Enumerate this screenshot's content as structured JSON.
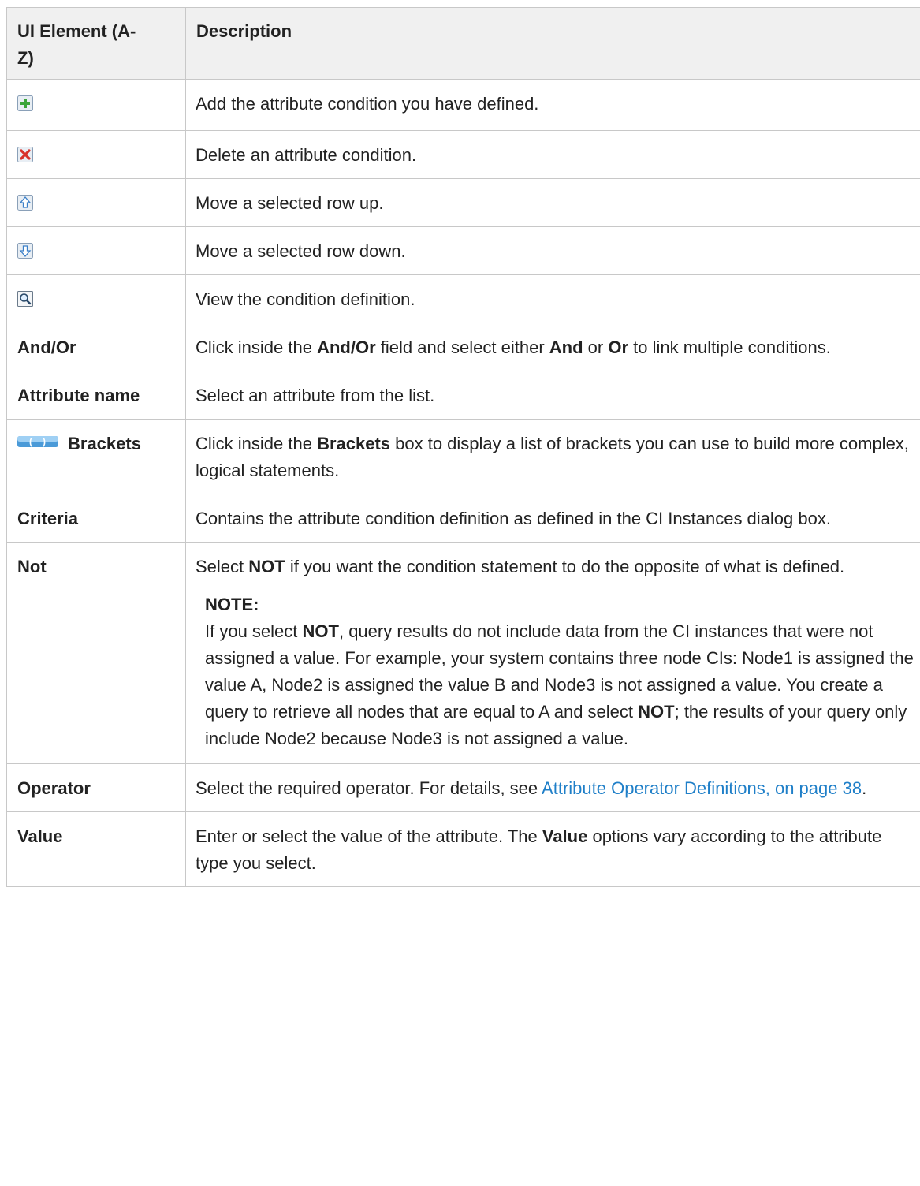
{
  "table": {
    "headers": [
      "UI Element (A-Z)",
      "Description"
    ],
    "header_element_line1": "UI Element (A-",
    "header_element_line2": "Z)"
  },
  "rows": {
    "add": {
      "icon": "add-icon",
      "desc": "Add the attribute condition you have defined."
    },
    "delete": {
      "icon": "delete-icon",
      "desc": "Delete an attribute condition."
    },
    "up": {
      "icon": "move-up-icon",
      "desc": "Move a selected row up."
    },
    "down": {
      "icon": "move-down-icon",
      "desc": "Move a selected row down."
    },
    "view": {
      "icon": "view-icon",
      "desc": "View the condition definition."
    },
    "andor": {
      "name": "And/Or",
      "d1": "Click inside the ",
      "b1": "And/Or",
      "d2": " field and select either ",
      "b2": "And",
      "d3": " or ",
      "b3": "Or",
      "d4": " to link multiple conditions."
    },
    "attrname": {
      "name": "Attribute name",
      "desc": "Select an attribute from the list."
    },
    "brackets": {
      "icon": "brackets-icon",
      "name": "Brackets",
      "d1": "Click inside the ",
      "b1": "Brackets",
      "d2": " box to display a list of brackets you can use to build more complex, logical statements."
    },
    "criteria": {
      "name": "Criteria",
      "desc": "Contains the attribute condition definition as defined in the CI Instances dialog box."
    },
    "not": {
      "name": "Not",
      "d1": "Select ",
      "b1": "NOT",
      "d2": " if you want the condition statement to do the opposite of what is defined.",
      "note_title": "NOTE:",
      "n1": "If you select ",
      "nb1": "NOT",
      "n2": ", query results do not include data from the CI instances that were not assigned a value. For example, your system contains three node CIs: Node1 is assigned the value A, Node2 is assigned the value B and Node3 is not assigned a value. You create a query to retrieve all nodes that are equal to A and select ",
      "nb2": "NOT",
      "n3": "; the results of your query only include Node2 because Node3 is not assigned a value."
    },
    "operator": {
      "name": "Operator",
      "d1": "Select the required operator. For details, see ",
      "link": "Attribute Operator Definitions, on page 38",
      "d2": "."
    },
    "value": {
      "name": "Value",
      "d1": "Enter or select the value of the attribute. The ",
      "b1": "Value",
      "d2": " options vary according to the attribute type you select."
    }
  },
  "colors": {
    "link": "#1f7fc8",
    "header_bg": "#f0f0f0",
    "border": "#c8c8c8"
  }
}
